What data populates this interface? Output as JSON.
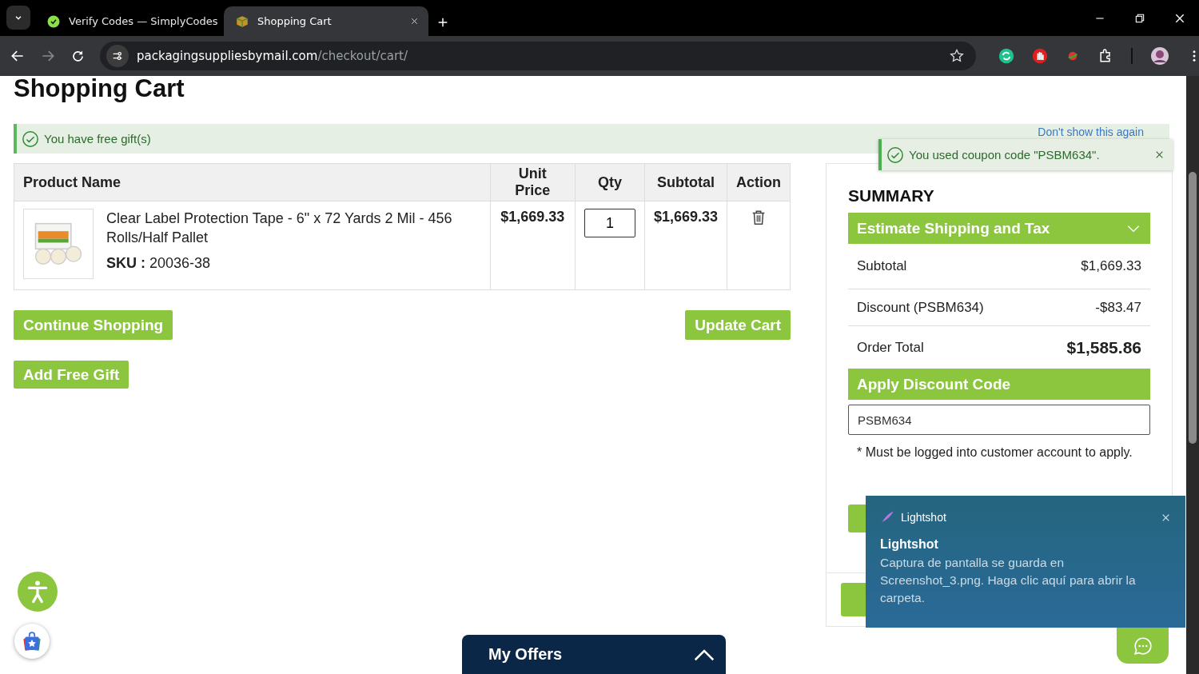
{
  "browser": {
    "tabs": [
      {
        "title": "Verify Codes — SimplyCodes",
        "selected": false
      },
      {
        "title": "Shopping Cart",
        "selected": true
      }
    ],
    "url_host": "packagingsuppliesbymail.com",
    "url_path": "/checkout/cart/"
  },
  "page": {
    "title": "Shopping Cart"
  },
  "gift_notice": {
    "message": "You have free gift(s)",
    "link": "Don't show this again"
  },
  "coupon_toast": {
    "message": "You used coupon code \"PSBM634\"."
  },
  "cart_table": {
    "columns": [
      "Product Name",
      "Unit Price",
      "Qty",
      "Subtotal",
      "Action"
    ],
    "rows": [
      {
        "product": "Clear Label Protection Tape - 6\" x 72 Yards 2 Mil - 456 Rolls/Half Pallet",
        "sku_label": "SKU :",
        "sku": "20036-38",
        "unit_price": "$1,669.33",
        "qty": "1",
        "subtotal": "$1,669.33"
      }
    ]
  },
  "buttons": [
    "Continue Shopping",
    "Update Cart",
    "Add Free Gift"
  ],
  "summary": {
    "title": "SUMMARY",
    "shipping_header": "Estimate Shipping and Tax",
    "lines": [
      {
        "label": "Subtotal",
        "value": "$1,669.33",
        "kind": "line"
      },
      {
        "label": "Discount (PSBM634)",
        "value": "-$83.47",
        "kind": "line"
      },
      {
        "label": "Order Total",
        "value": "$1,585.86",
        "kind": "total"
      }
    ],
    "discount_header": "Apply Discount Code",
    "discount_code": "PSBM634",
    "note": "* Must be logged into customer account to apply."
  },
  "notification": {
    "app": "Lightshot",
    "title": "Lightshot",
    "body": "Captura de pantalla se guarda en Screenshot_3.png. Haga clic aquí para abrir la carpeta."
  },
  "offers_bar": {
    "label": "My Offers"
  }
}
